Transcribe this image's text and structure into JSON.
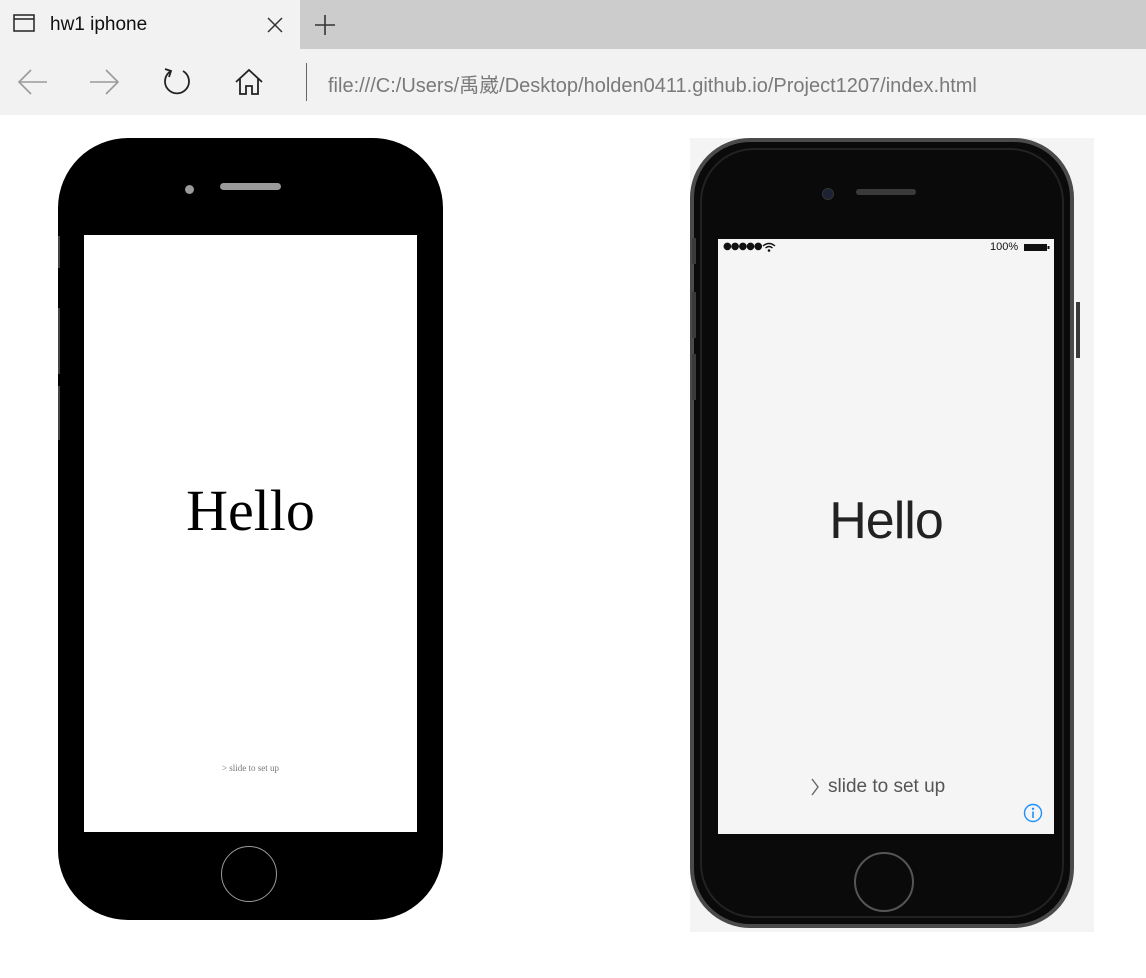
{
  "browser": {
    "tab": {
      "title": "hw1 iphone",
      "icon": "window-icon",
      "close_icon": "close-icon"
    },
    "new_tab_icon": "plus-icon",
    "nav": {
      "back_icon": "arrow-left-icon",
      "forward_icon": "arrow-right-icon",
      "refresh_icon": "refresh-icon",
      "home_icon": "home-icon"
    },
    "address": "file:///C:/Users/禹崴/Desktop/holden0411.github.io/Project1207/index.html"
  },
  "page": {
    "css_phone": {
      "hello": "Hello",
      "slide_text": "> slide to set up"
    },
    "photo_phone": {
      "signal": "●●●●●",
      "battery": "100%",
      "hello": "Hello",
      "slide_text": "slide to set up",
      "info_icon": "info-icon"
    }
  }
}
